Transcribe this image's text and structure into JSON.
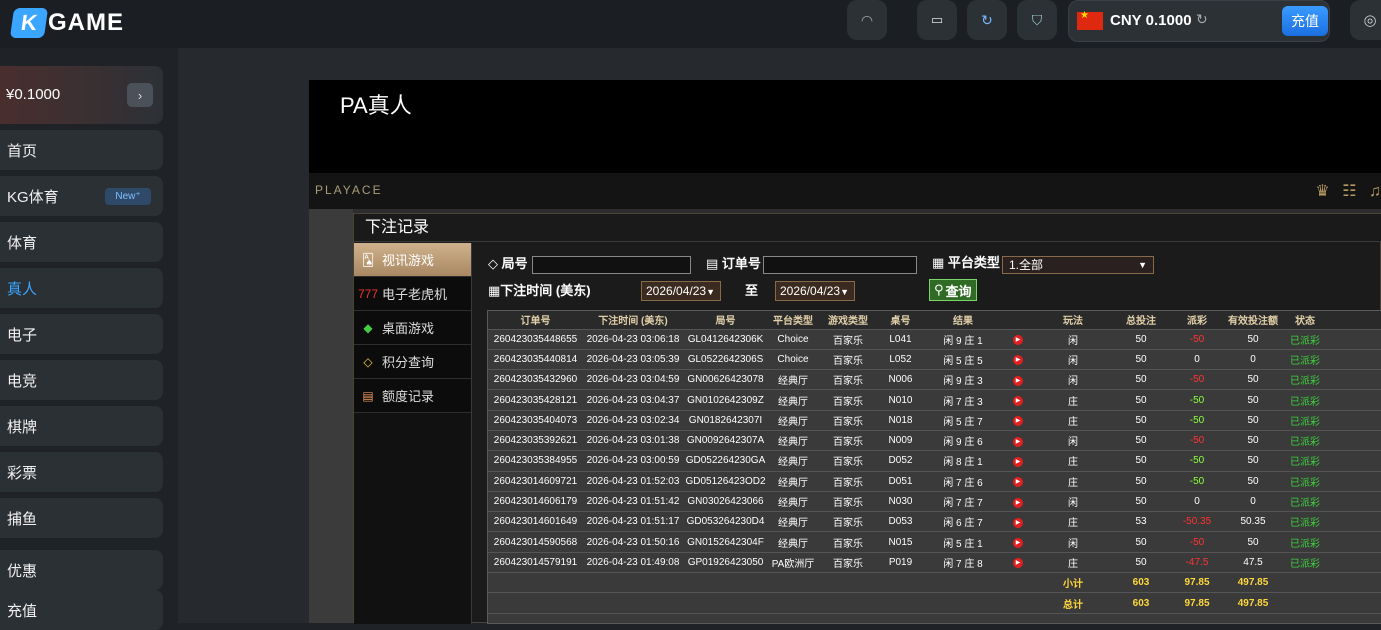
{
  "brand": {
    "logo_letter": "K",
    "logo_text": "GAME"
  },
  "topbar": {
    "currency": "CNY",
    "amount": "0.1000",
    "recharge_label": "充值"
  },
  "sidebar": {
    "balance": "¥0.1000",
    "items": [
      {
        "label": "首页"
      },
      {
        "label": "KG体育",
        "badge": "New⁺"
      },
      {
        "label": "体育"
      },
      {
        "label": "真人"
      },
      {
        "label": "电子"
      },
      {
        "label": "电竞"
      },
      {
        "label": "棋牌"
      },
      {
        "label": "彩票"
      },
      {
        "label": "捕鱼"
      },
      {
        "label": "优惠"
      },
      {
        "label": "充值"
      }
    ]
  },
  "game": {
    "title": "PA真人",
    "provider_logo": "PLAYACE"
  },
  "panel": {
    "title": "下注记录",
    "menu": [
      {
        "icon": "cards-icon",
        "label": "视讯游戏"
      },
      {
        "icon": "slot-icon",
        "label": "电子老虎机"
      },
      {
        "icon": "table-icon",
        "label": "桌面游戏"
      },
      {
        "icon": "diamond-icon",
        "label": "积分查询"
      },
      {
        "icon": "document-icon",
        "label": "额度记录"
      }
    ],
    "filters": {
      "round_label": "局号",
      "order_label": "订单号",
      "platform_label": "平台类型",
      "platform_value": "1.全部",
      "time_label": "下注时间 (美东)",
      "date_from": "2026/04/23",
      "to_label": "至",
      "date_to": "2026/04/23",
      "search_label": "查询"
    },
    "columns": [
      "订单号",
      "下注时间 (美东)",
      "局号",
      "平台类型",
      "游戏类型",
      "桌号",
      "结果",
      "",
      "玩法",
      "总投注",
      "派彩",
      "有效投注额",
      "状态"
    ],
    "rows": [
      [
        "260423035448655",
        "2026-04-23 03:06:18",
        "GL0412642306K",
        "Choice",
        "百家乐",
        "L041",
        "闲 9 庄 1",
        "闲",
        "50",
        "-50",
        "50",
        "已派彩"
      ],
      [
        "260423035440814",
        "2026-04-23 03:05:39",
        "GL0522642306S",
        "Choice",
        "百家乐",
        "L052",
        "闲 5 庄 5",
        "闲",
        "50",
        "0",
        "0",
        "已派彩"
      ],
      [
        "260423035432960",
        "2026-04-23 03:04:59",
        "GN00626423078",
        "经典厅",
        "百家乐",
        "N006",
        "闲 9 庄 3",
        "闲",
        "50",
        "-50",
        "50",
        "已派彩"
      ],
      [
        "260423035428121",
        "2026-04-23 03:04:37",
        "GN0102642309Z",
        "经典厅",
        "百家乐",
        "N010",
        "闲 7 庄 3",
        "庄",
        "50",
        "-50",
        "50",
        "已派彩"
      ],
      [
        "260423035404073",
        "2026-04-23 03:02:34",
        "GN0182642307I",
        "经典厅",
        "百家乐",
        "N018",
        "闲 5 庄 7",
        "庄",
        "50",
        "-50",
        "50",
        "已派彩"
      ],
      [
        "260423035392621",
        "2026-04-23 03:01:38",
        "GN0092642307A",
        "经典厅",
        "百家乐",
        "N009",
        "闲 9 庄 6",
        "闲",
        "50",
        "-50",
        "50",
        "已派彩"
      ],
      [
        "260423035384955",
        "2026-04-23 03:00:59",
        "GD052264230GA",
        "经典厅",
        "百家乐",
        "D052",
        "闲 8 庄 1",
        "庄",
        "50",
        "-50",
        "50",
        "已派彩"
      ],
      [
        "260423014609721",
        "2026-04-23 01:52:03",
        "GD05126423OD2",
        "经典厅",
        "百家乐",
        "D051",
        "闲 7 庄 6",
        "庄",
        "50",
        "-50",
        "50",
        "已派彩"
      ],
      [
        "260423014606179",
        "2026-04-23 01:51:42",
        "GN03026423066",
        "经典厅",
        "百家乐",
        "N030",
        "闲 7 庄 7",
        "闲",
        "50",
        "0",
        "0",
        "已派彩"
      ],
      [
        "260423014601649",
        "2026-04-23 01:51:17",
        "GD053264230D4",
        "经典厅",
        "百家乐",
        "D053",
        "闲 6 庄 7",
        "庄",
        "53",
        "-50.35",
        "50.35",
        "已派彩"
      ],
      [
        "260423014590568",
        "2026-04-23 01:50:16",
        "GN0152642304F",
        "经典厅",
        "百家乐",
        "N015",
        "闲 5 庄 1",
        "闲",
        "50",
        "-50",
        "50",
        "已派彩"
      ],
      [
        "260423014579191",
        "2026-04-23 01:49:08",
        "GP01926423050",
        "PA欧洲厅",
        "百家乐",
        "P019",
        "闲 7 庄 8",
        "庄",
        "50",
        "-47.5",
        "47.5",
        "已派彩"
      ]
    ],
    "subtotal": {
      "label": "小计",
      "bet": "603",
      "payout": "97.85",
      "valid": "497.85"
    },
    "total": {
      "label": "总计",
      "bet": "603",
      "payout": "97.85",
      "valid": "497.85"
    }
  }
}
